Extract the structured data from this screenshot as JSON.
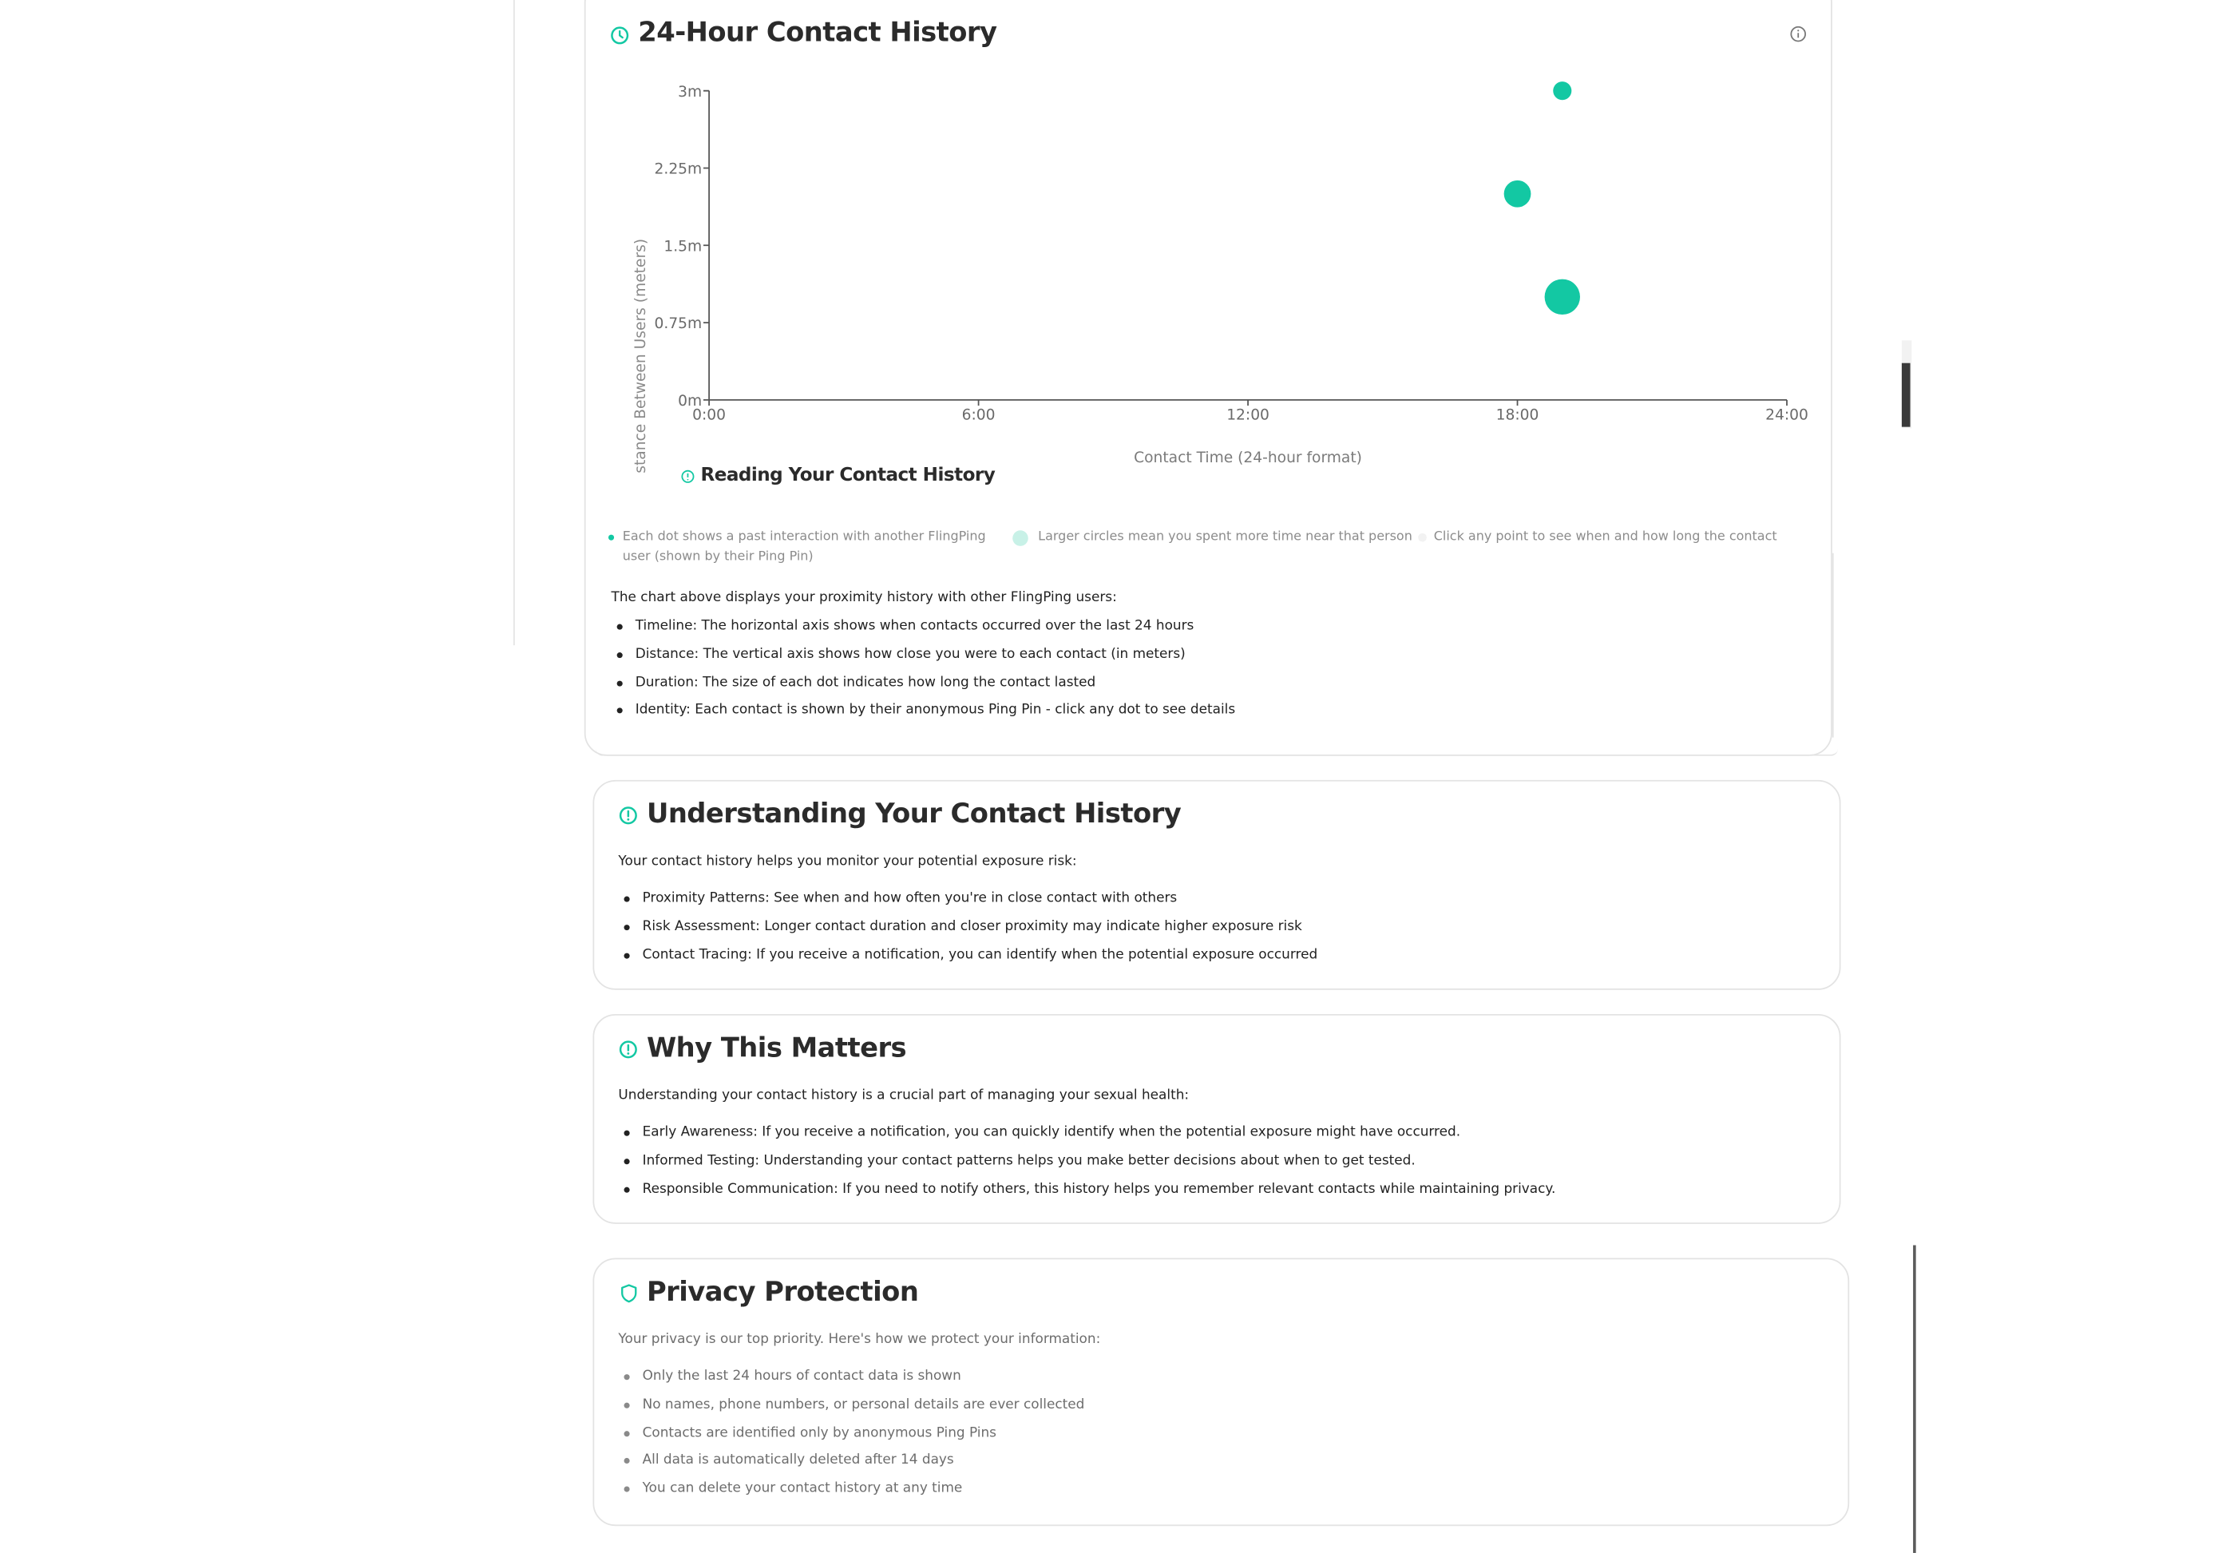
{
  "colors": {
    "accent": "#13c8a3",
    "text": "#222222",
    "muted": "#6d6d6d",
    "border": "#e3e3e3"
  },
  "history_card": {
    "title": "24-Hour Contact History",
    "title_icon": "clock-icon",
    "info_icon": "info-icon",
    "reading_title": "Reading Your Contact History",
    "legend": [
      "Each dot shows a past interaction with another FlingPing user (shown by their Ping Pin)",
      "Larger circles mean you spent more time near that person",
      "Click any point to see when and how long the contact"
    ],
    "intro": "The chart above displays your proximity history with other FlingPing users:",
    "bullets": [
      "Timeline: The horizontal axis shows when contacts occurred over the last 24 hours",
      "Distance: The vertical axis shows how close you were to each contact (in meters)",
      "Duration: The size of each dot indicates how long the contact lasted",
      "Identity: Each contact is shown by their anonymous Ping Pin - click any dot to see details"
    ]
  },
  "chart_data": {
    "type": "scatter",
    "xlabel": "Contact Time (24-hour format)",
    "ylabel": "stance Between Users (meters)",
    "xlim": [
      0,
      24
    ],
    "ylim": [
      0,
      3
    ],
    "xticks": [
      "0:00",
      "6:00",
      "12:00",
      "18:00",
      "24:00"
    ],
    "yticks": [
      "0m",
      "0.75m",
      "1.5m",
      "2.25m",
      "3m"
    ],
    "grid": false,
    "points": [
      {
        "x": 19,
        "y": 3.0,
        "size": "small"
      },
      {
        "x": 18,
        "y": 2.0,
        "size": "medium"
      },
      {
        "x": 19,
        "y": 1.0,
        "size": "large"
      }
    ],
    "color": "#13c8a3"
  },
  "understanding_card": {
    "title": "Understanding Your Contact History",
    "title_icon": "alert-circle-icon",
    "intro": "Your contact history helps you monitor your potential exposure risk:",
    "bullets": [
      "Proximity Patterns: See when and how often you're in close contact with others",
      "Risk Assessment: Longer contact duration and closer proximity may indicate higher exposure risk",
      "Contact Tracing: If you receive a notification, you can identify when the potential exposure occurred"
    ]
  },
  "matters_card": {
    "title": "Why This Matters",
    "title_icon": "alert-circle-icon",
    "intro": "Understanding your contact history is a crucial part of managing your sexual health:",
    "bullets": [
      "Early Awareness: If you receive a notification, you can quickly identify when the potential exposure might have occurred.",
      "Informed Testing: Understanding your contact patterns helps you make better decisions about when to get tested.",
      "Responsible Communication: If you need to notify others, this history helps you remember relevant contacts while maintaining privacy."
    ]
  },
  "privacy_card": {
    "title": "Privacy Protection",
    "title_icon": "shield-icon",
    "intro": "Your privacy is our top priority. Here's how we protect your information:",
    "bullets": [
      "Only the last 24 hours of contact data is shown",
      "No names, phone numbers, or personal details are ever collected",
      "Contacts are identified only by anonymous Ping Pins",
      "All data is automatically deleted after 14 days",
      "You can delete your contact history at any time"
    ]
  }
}
